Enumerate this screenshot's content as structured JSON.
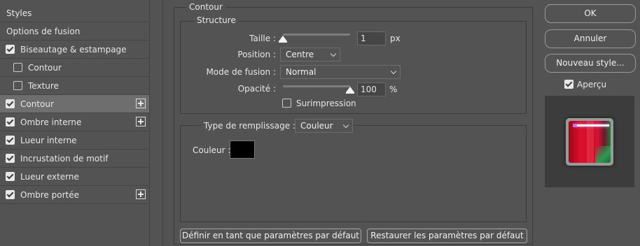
{
  "left_panel": {
    "header": "Styles",
    "blending_options": "Options de fusion",
    "items": [
      {
        "label": "Biseautage & estampage",
        "checked": true,
        "sub": false,
        "selected": false,
        "plus": false
      },
      {
        "label": "Contour",
        "checked": false,
        "sub": true,
        "selected": false,
        "plus": false
      },
      {
        "label": "Texture",
        "checked": false,
        "sub": true,
        "selected": false,
        "plus": false
      },
      {
        "label": "Contour",
        "checked": true,
        "sub": false,
        "selected": true,
        "plus": true
      },
      {
        "label": "Ombre interne",
        "checked": true,
        "sub": false,
        "selected": false,
        "plus": true
      },
      {
        "label": "Lueur interne",
        "checked": true,
        "sub": false,
        "selected": false,
        "plus": false
      },
      {
        "label": "Incrustation de motif",
        "checked": true,
        "sub": false,
        "selected": false,
        "plus": false
      },
      {
        "label": "Lueur externe",
        "checked": true,
        "sub": false,
        "selected": false,
        "plus": false
      },
      {
        "label": "Ombre portée",
        "checked": true,
        "sub": false,
        "selected": false,
        "plus": true
      }
    ]
  },
  "main": {
    "section_title": "Contour",
    "structure": {
      "title": "Structure",
      "taille_label": "Taille :",
      "taille_value": "1",
      "taille_unit": "px",
      "taille_slider_level": 0.0,
      "position_label": "Position :",
      "position_value": "Centre",
      "mode_label": "Mode de fusion :",
      "mode_value": "Normal",
      "opacite_label": "Opacité :",
      "opacite_value": "100",
      "opacite_unit": "%",
      "opacite_slider_level": 1.0,
      "surimpression_label": "Surimpression",
      "surimpression_checked": false
    },
    "fill": {
      "type_label": "Type de remplissage :",
      "type_value": "Couleur",
      "couleur_label": "Couleur :",
      "couleur_value": "#000000"
    },
    "buttons": {
      "default_label": "Définir en tant que paramètres par défaut",
      "reset_label": "Restaurer les paramètres par défaut"
    }
  },
  "right_panel": {
    "ok_label": "OK",
    "cancel_label": "Annuler",
    "new_style_label": "Nouveau style...",
    "apercu_label": "Aperçu",
    "apercu_checked": true
  }
}
